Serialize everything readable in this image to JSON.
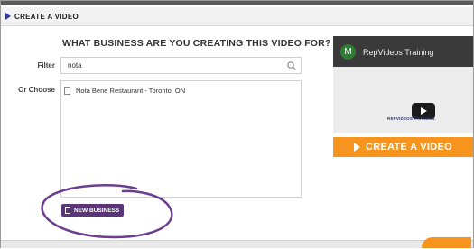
{
  "dialog": {
    "title": "CREATE A VIDEO"
  },
  "form": {
    "heading": "WHAT BUSINESS ARE YOU CREATING THIS VIDEO FOR?",
    "filter_label": "Filter",
    "filter_value": "nota",
    "choose_label": "Or Choose",
    "businesses": [
      "Nota Bene Restaurant - Toronto, ON"
    ],
    "new_business_label": "NEW BUSINESS"
  },
  "video": {
    "avatar_letter": "M",
    "title": "RepVideos Training",
    "caption": "REPVIDEOS TRAINING"
  },
  "cta": {
    "label": "CREATE A VIDEO"
  },
  "colors": {
    "accent_purple": "#5a3578",
    "orange": "#f7941d",
    "annotation": "#6a3d8f"
  }
}
